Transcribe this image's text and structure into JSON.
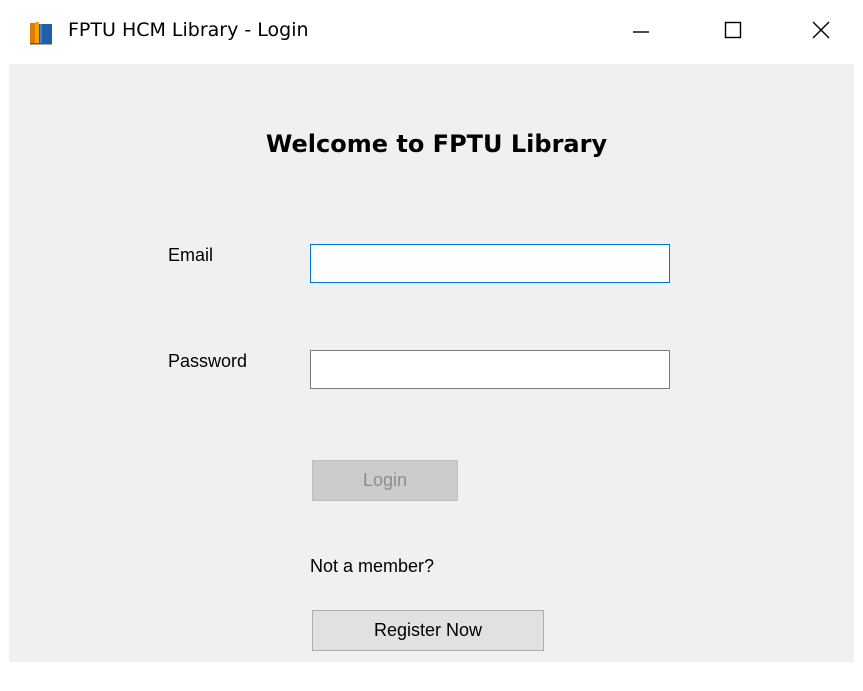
{
  "window": {
    "title": "FPTU HCM Library - Login"
  },
  "icons": {
    "app": "book-app-icon",
    "minimize": "minimize-icon",
    "maximize": "maximize-icon",
    "close": "close-icon"
  },
  "login_form": {
    "heading": "Welcome to FPTU Library",
    "email_label": "Email",
    "email_value": "",
    "password_label": "Password",
    "password_value": "",
    "login_label": "Login",
    "login_enabled": false,
    "not_member_text": "Not a member?",
    "register_label": "Register Now"
  },
  "colors": {
    "client_background": "#f0f0f0",
    "focus_border": "#0078d7",
    "disabled_button": "#cccccc",
    "disabled_text": "#8d8d8d",
    "button_background": "#e1e1e1"
  }
}
